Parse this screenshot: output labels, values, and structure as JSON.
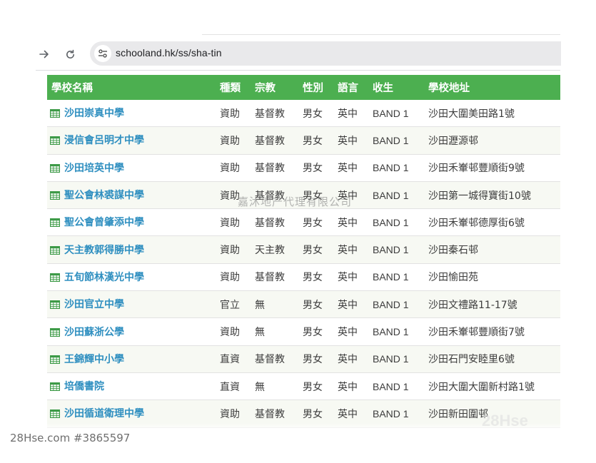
{
  "browser": {
    "url": "schooland.hk/ss/sha-tin",
    "forward_icon": "→",
    "reload_icon": "↻"
  },
  "table": {
    "headers": [
      "學校名稱",
      "種類",
      "宗教",
      "性別",
      "語言",
      "收生",
      "學校地址"
    ],
    "rows": [
      {
        "name": "沙田崇真中學",
        "type": "資助",
        "religion": "基督教",
        "gender": "男女",
        "language": "英中",
        "band": "BAND 1",
        "address": "沙田大圍美田路1號"
      },
      {
        "name": "浸信會呂明才中學",
        "type": "資助",
        "religion": "基督教",
        "gender": "男女",
        "language": "英中",
        "band": "BAND 1",
        "address": "沙田瀝源邨"
      },
      {
        "name": "沙田培英中學",
        "type": "資助",
        "religion": "基督教",
        "gender": "男女",
        "language": "英中",
        "band": "BAND 1",
        "address": "沙田禾輋邨豐順街9號"
      },
      {
        "name": "聖公會林裘謀中學",
        "type": "資助",
        "religion": "基督教",
        "gender": "男女",
        "language": "英中",
        "band": "BAND 1",
        "address": "沙田第一城得寶街10號"
      },
      {
        "name": "聖公會曾肇添中學",
        "type": "資助",
        "religion": "基督教",
        "gender": "男女",
        "language": "英中",
        "band": "BAND 1",
        "address": "沙田禾輋邨德厚街6號"
      },
      {
        "name": "天主教郭得勝中學",
        "type": "資助",
        "religion": "天主教",
        "gender": "男女",
        "language": "英中",
        "band": "BAND 1",
        "address": "沙田秦石邨"
      },
      {
        "name": "五旬節林漢光中學",
        "type": "資助",
        "religion": "基督教",
        "gender": "男女",
        "language": "英中",
        "band": "BAND 1",
        "address": "沙田愉田苑"
      },
      {
        "name": "沙田官立中學",
        "type": "官立",
        "religion": "無",
        "gender": "男女",
        "language": "英中",
        "band": "BAND 1",
        "address": "沙田文禮路11-17號"
      },
      {
        "name": "沙田蘇浙公學",
        "type": "資助",
        "religion": "無",
        "gender": "男女",
        "language": "英中",
        "band": "BAND 1",
        "address": "沙田禾輋邨豐順街7號"
      },
      {
        "name": "王錦輝中小學",
        "type": "直資",
        "religion": "基督教",
        "gender": "男女",
        "language": "英中",
        "band": "BAND 1",
        "address": "沙田石門安睦里6號"
      },
      {
        "name": "培僑書院",
        "type": "直資",
        "religion": "無",
        "gender": "男女",
        "language": "英中",
        "band": "BAND 1",
        "address": "沙田大圍大圍新村路1號"
      },
      {
        "name": "沙田循道衛理中學",
        "type": "資助",
        "religion": "基督教",
        "gender": "男女",
        "language": "英中",
        "band": "BAND 1",
        "address": "沙田新田圍邨"
      }
    ]
  },
  "watermark": "嘉沐地产代理有限公司",
  "corner_watermark": "28Hse",
  "footer": {
    "listing_id": "28Hse.com #3865597"
  },
  "colors": {
    "header_bg": "#4caf50",
    "link": "#2f8fc0",
    "icon": "#3d9a47"
  }
}
